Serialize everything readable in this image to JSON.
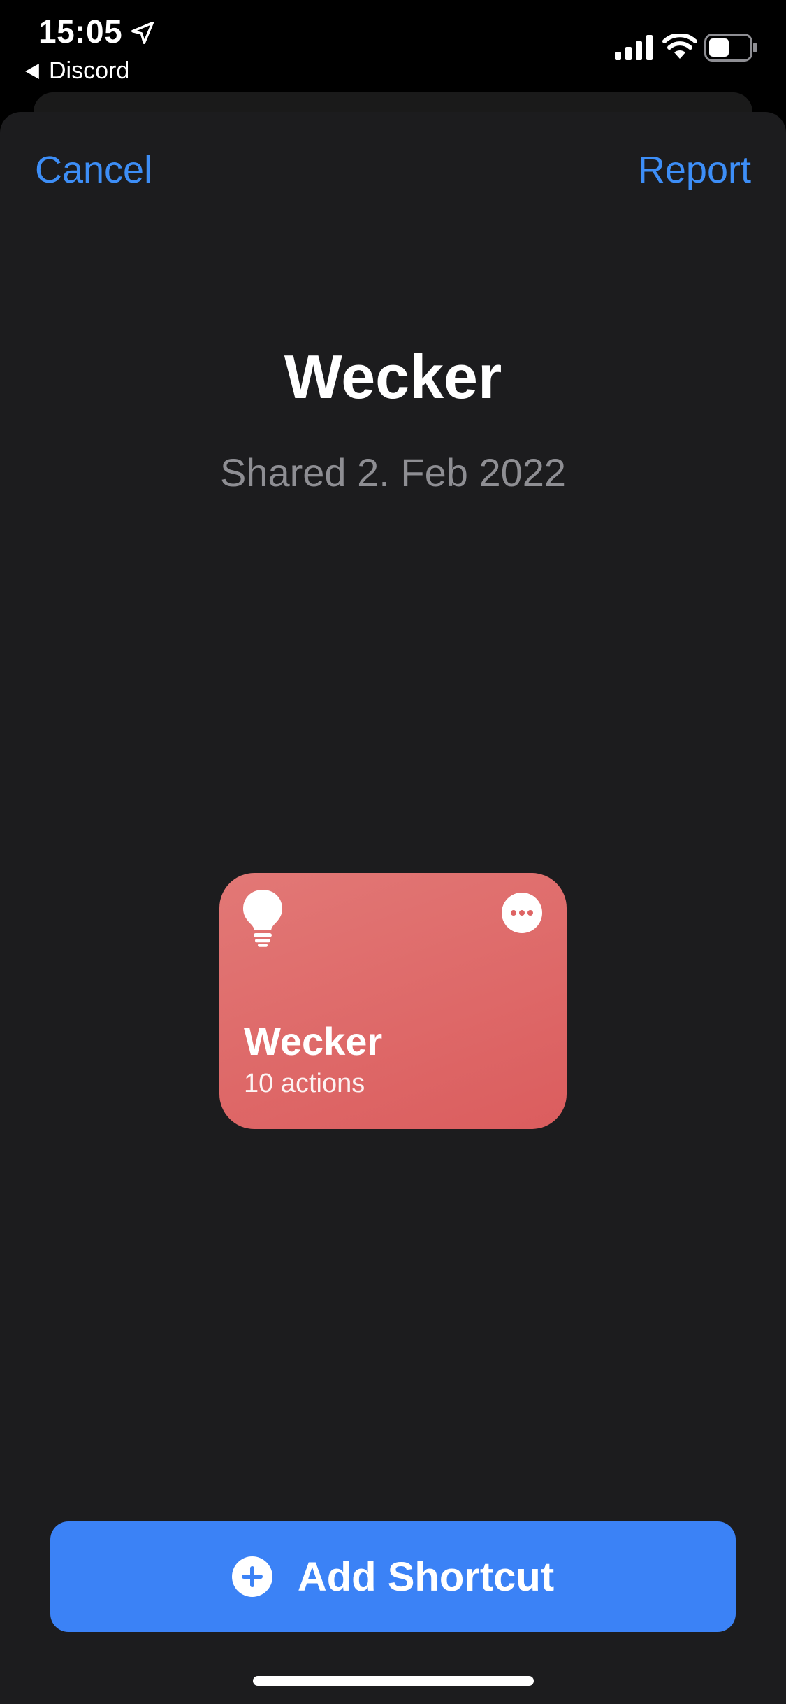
{
  "status_bar": {
    "time": "15:05",
    "back_app": "Discord",
    "icons": [
      "location-arrow-icon",
      "signal-icon",
      "wifi-icon",
      "battery-icon"
    ]
  },
  "nav": {
    "cancel_label": "Cancel",
    "report_label": "Report"
  },
  "header": {
    "title": "Wecker",
    "subtitle": "Shared 2. Feb 2022"
  },
  "shortcut_card": {
    "name": "Wecker",
    "actions": "10 actions",
    "icon": "lightbulb-icon",
    "color": "#de6a6a"
  },
  "primary_action": {
    "label": "Add Shortcut",
    "icon": "plus-circle-icon",
    "color": "#3b82f6"
  },
  "colors": {
    "accent": "#3d8ef7",
    "background": "#1c1c1e"
  }
}
